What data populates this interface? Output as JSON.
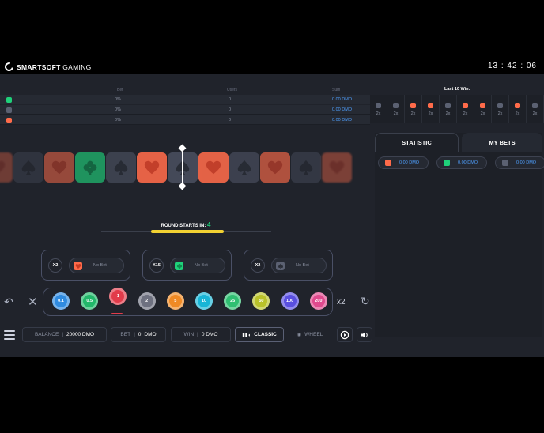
{
  "header": {
    "brand_bold": "SMARTSOFT",
    "brand_light": "GAMING",
    "clock": "13 : 42 : 06"
  },
  "bets_table": {
    "columns": [
      "Bet",
      "Users",
      "Sum"
    ],
    "rows": [
      {
        "color": "#1fd17a",
        "bet": "0%",
        "users": "0",
        "sum": "0.00 DMO"
      },
      {
        "color": "#5b6172",
        "bet": "0%",
        "users": "0",
        "sum": "0.00 DMO"
      },
      {
        "color": "#ff6b4a",
        "bet": "0%",
        "users": "0",
        "sum": "0.00 DMO"
      }
    ]
  },
  "last10": {
    "title": "Last 10 Win:",
    "items": [
      {
        "color": "#5b6172",
        "mult": "2x"
      },
      {
        "color": "#5b6172",
        "mult": "2x"
      },
      {
        "color": "#ff6b4a",
        "mult": "2x"
      },
      {
        "color": "#ff6b4a",
        "mult": "2x"
      },
      {
        "color": "#5b6172",
        "mult": "2x"
      },
      {
        "color": "#ff6b4a",
        "mult": "2x"
      },
      {
        "color": "#ff6b4a",
        "mult": "2x"
      },
      {
        "color": "#5b6172",
        "mult": "2x"
      },
      {
        "color": "#ff6b4a",
        "mult": "2x"
      },
      {
        "color": "#5b6172",
        "mult": "2x"
      }
    ]
  },
  "reel": [
    "heart",
    "spade",
    "heart",
    "clover",
    "spade",
    "heart",
    "spade",
    "heart",
    "spade",
    "heart",
    "spade",
    "heart"
  ],
  "round": {
    "label": "ROUND STARTS IN:",
    "count": "4",
    "progress": 0.43
  },
  "bet_boxes": [
    {
      "mult": "X2",
      "suit": "heart",
      "color": "#ff6b4a",
      "label": "No Bet"
    },
    {
      "mult": "X15",
      "suit": "clover",
      "color": "#1fd17a",
      "label": "No Bet"
    },
    {
      "mult": "X2",
      "suit": "spade",
      "color": "#5b6172",
      "label": "No Bet"
    }
  ],
  "chips": [
    {
      "label": "0.1",
      "color": "#2f8be0"
    },
    {
      "label": "0.5",
      "color": "#22b86a"
    },
    {
      "label": "1",
      "color": "#e23b4a",
      "selected": true
    },
    {
      "label": "2",
      "color": "#6e7180"
    },
    {
      "label": "5",
      "color": "#f08a24"
    },
    {
      "label": "10",
      "color": "#18b5d6"
    },
    {
      "label": "25",
      "color": "#2fbf71"
    },
    {
      "label": "50",
      "color": "#b9c22a"
    },
    {
      "label": "100",
      "color": "#5a4fe0"
    },
    {
      "label": "200",
      "color": "#e04a8e"
    }
  ],
  "controls": {
    "double": "x2"
  },
  "panel": {
    "tabs": [
      "STATISTIC",
      "MY BETS"
    ],
    "stats": [
      {
        "color": "#ff6b4a",
        "value": "0.00 DMO"
      },
      {
        "color": "#1fd17a",
        "value": "0.00 DMO"
      },
      {
        "color": "#5b6172",
        "value": "0.00 DMO"
      }
    ]
  },
  "bottom": {
    "balance_label": "BALANCE",
    "balance_value": "20000 DMO",
    "bet_label": "BET",
    "bet_value": "0",
    "bet_unit": "DMO",
    "win_label": "WIN",
    "win_value": "0 DMO",
    "classic_label": "CLASSIC",
    "wheel_label": "WHEEL"
  },
  "colors": {
    "heart": "#ff6b4a",
    "clover": "#1fd17a",
    "spade": "#5b6172"
  }
}
